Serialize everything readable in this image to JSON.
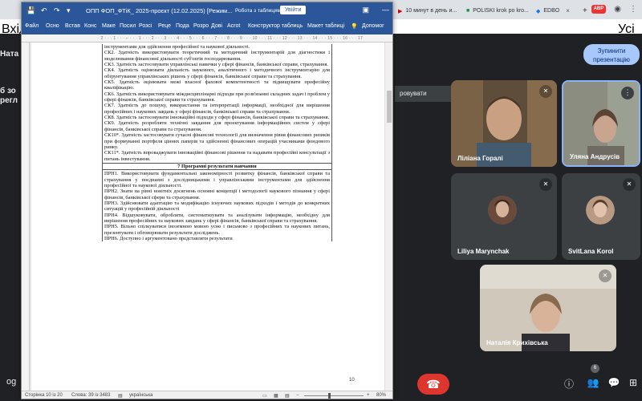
{
  "browser": {
    "tabs": [
      {
        "label": "10 минут в день и..."
      },
      {
        "label": "POLISKI krok po kro..."
      },
      {
        "label": "EDBO"
      }
    ],
    "bookmarks": {
      "left": "Вхід",
      "right": "Усі"
    },
    "abp_label": "ABP"
  },
  "meet": {
    "left_top_label": "Ната",
    "left_mid_label_1": "б зо",
    "left_mid_label_2": "регл",
    "stop_presenting": "Зупинити презентацію",
    "present_bar_label": "ровувати",
    "participants": [
      {
        "name": "Ліліана Горалі"
      },
      {
        "name": "Уляна Андрусів"
      },
      {
        "name": "Liliya Marynchak"
      },
      {
        "name": "SvitLana Korol"
      },
      {
        "name": "Наталія Крихівська"
      }
    ],
    "meeting_code": "og",
    "participants_count": "6",
    "colors": {
      "end_call": "#dc362e",
      "background": "#202124"
    }
  },
  "word": {
    "title": "ОПП ФОП_ФТіК_ 2025-проєкт (12.02.2025) [Режим...",
    "table_tools": "Робота з таблицями",
    "login": "Увійти",
    "ribbon_tabs": [
      "Файл",
      "Осно",
      "Встав",
      "Конс",
      "Маке",
      "Посил",
      "Розсі",
      "Реце",
      "Пода",
      "Розро",
      "Дові",
      "Acrot",
      "Конструктор таблиць",
      "Макет таблиці",
      "Допомог"
    ],
    "ruler": "· 2 · · · 1 · · · ⌐ · · · 1 · · · 2 · · · 3 · · · 4 · · · 5 · · · 6 · · · 7 · · · 8 · · · 9 · · · 10 · · · 11 · · · 12 · · · 13 · · · 14 · · · 15 · · · 16 · · · 17",
    "document": {
      "lines_top": [
        "інструментами для здійснення професійної та наукової діяльності.",
        "СК2. Здатність використовувати теоретичний та методичний інструментарій для діагностики і моделювання фінансової діяльності суб'єктів господарювання.",
        "СК3. Здатність застосовувати управлінські навички у сфері фінансів, банківської справи, страхування.",
        "СК4. Здатність оцінювати діяльність наукового, аналітичного і методичного інструментарію для обґрунтування управлінських рішень у сфері фінансів, банківської справи та страхування.",
        "СК5. Здатність оцінювати межі власної фахової компетентності та підвищувати професійну кваліфікацію.",
        "СК6. Здатність використовувати міждисциплінарні підходи при розв'язанні складних задач і проблем у сфері фінансів, банківської справи та страхування.",
        "СК7. Здатність до пошуку, використання та інтерпретації інформації, необхідної для вирішення професійних і наукових завдань у сфері фінансів, банківської справи та страхування.",
        "СК8. Здатність застосовувати інноваційні підходи у сфері фінансів, банківської справи та страхування.",
        "СК9. Здатність розробляти технічні завдання для проектування інформаційних систем у сфері фінансів, банківської справи та страхування.",
        "СК10*. Здатність застосовувати сучасні фінансові технології для визначення рівня фінансових ризиків при формуванні портфеля цінних паперів та здійсненні фінансових операцій учасниками фондового ринку.",
        "СК11*. Здатність впроваджувати інноваційні фінансові рішення та надавати професійні консультації з питань інвестування."
      ],
      "section_heading": "7 Програмні результати навчання",
      "lines_bottom": [
        "ПРН1. Використовувати фундаментальні закономірності розвитку фінансів, банківської справи та страхування у поєднанні з дослідницькими і управлінськими інструментами для здійснення професійної та наукової діяльності.",
        "ПРН2. Знати на рівні новітніх досягнень основні концепції і методології наукового пізнання у сфері фінансів, банківської сфери та страхування.",
        "ПРН3. Здійснювати адаптацію та модифікацію існуючих наукових підходів і методів до конкретних ситуацій у професійній діяльності",
        "ПРН4. Відшуковувати, обробляти, систематизувати та аналізувати інформацію, необхідну для вирішення професійних та наукових завдань у сфері фінансів, банківської справи та страхування.",
        "ПРН5. Вільно спілкуватися іноземною мовою усно і письмово з професійних та наукових питань, презентувати і обговорювати результати досліджень.",
        "ПРН6. Доступно і аргументовано представляти результати"
      ],
      "page_number": "10"
    },
    "status": {
      "page": "Сторінка 10 із 20",
      "words": "Слова: 39 із 3483",
      "language": "українська",
      "zoom": "80%"
    }
  }
}
